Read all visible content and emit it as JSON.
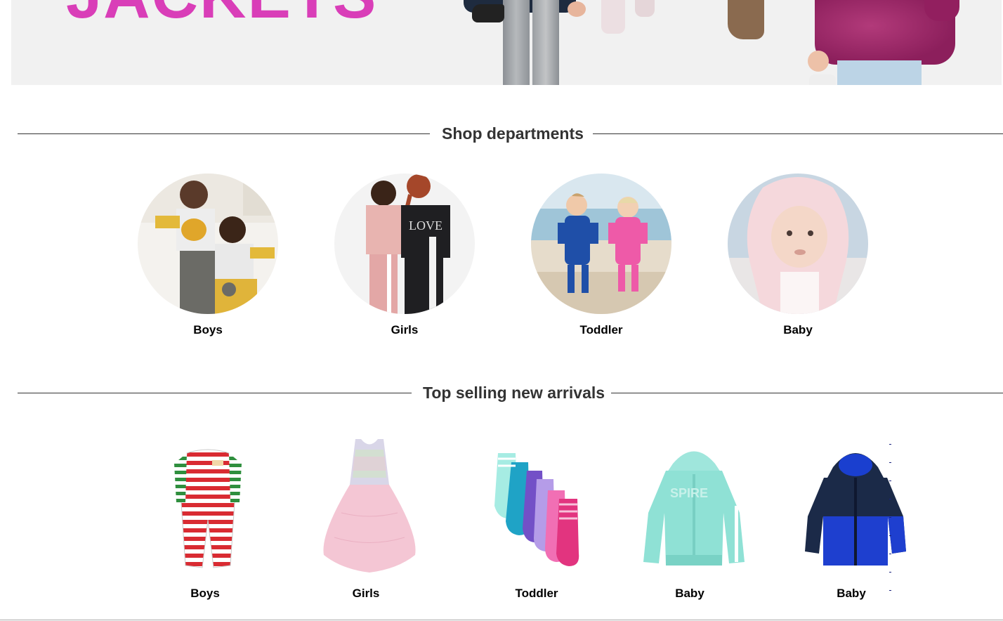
{
  "hero": {
    "title": "JACKETS",
    "colors": {
      "title": "#d93eb8",
      "background": "#f1f1f1"
    }
  },
  "departments": {
    "heading": "Shop departments",
    "items": [
      {
        "label": "Boys"
      },
      {
        "label": "Girls"
      },
      {
        "label": "Toddler"
      },
      {
        "label": "Baby"
      }
    ]
  },
  "arrivals": {
    "heading": "Top selling new arrivals",
    "items": [
      {
        "label": "Boys"
      },
      {
        "label": "Girls"
      },
      {
        "label": "Toddler"
      },
      {
        "label": "Baby"
      },
      {
        "label": "Baby"
      }
    ]
  }
}
